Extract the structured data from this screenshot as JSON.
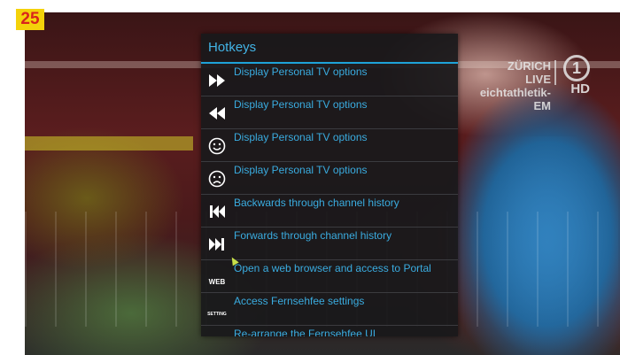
{
  "badge": {
    "number": "25"
  },
  "broadcast": {
    "line1": "ZÜRICH LIVE",
    "line2": "eichtathletik-EM",
    "channel_logo": "1",
    "hd": "HD"
  },
  "panel": {
    "title": "Hotkeys",
    "items": [
      {
        "icon": "fast-forward-icon",
        "label": "Display Personal TV options"
      },
      {
        "icon": "rewind-icon",
        "label": "Display Personal TV options"
      },
      {
        "icon": "smiley-icon",
        "label": "Display Personal TV options"
      },
      {
        "icon": "frown-icon",
        "label": "Display Personal TV options"
      },
      {
        "icon": "skip-back-icon",
        "label": "Backwards through channel history"
      },
      {
        "icon": "skip-forward-icon",
        "label": "Forwards through channel history"
      },
      {
        "icon": "web-icon",
        "icon_text": "WEB",
        "label": "Open a web browser and access to Portal"
      },
      {
        "icon": "setting-icon",
        "icon_text": "SETTING",
        "label": "Access Fernsehfee settings"
      },
      {
        "icon": "arrange-icon",
        "label": "Re-arrange the Fernsehfee UI"
      }
    ]
  },
  "colors": {
    "accent": "#1ea3d8",
    "label": "#3aace0",
    "badge_bg": "#f4d20a",
    "badge_text": "#d9251c"
  }
}
